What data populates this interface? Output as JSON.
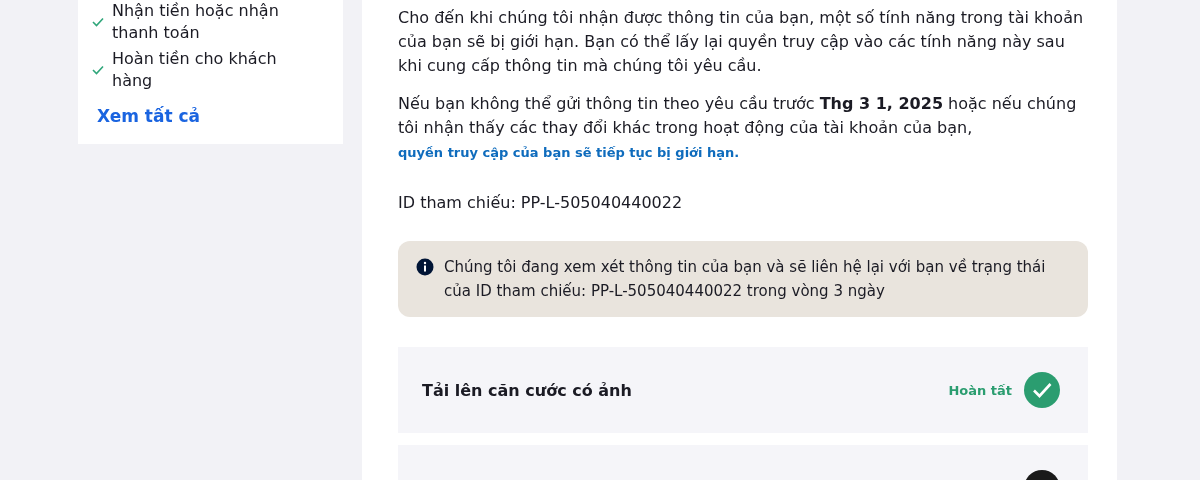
{
  "sidebar": {
    "features": [
      {
        "label": "Nhận tiền hoặc nhận thanh toán",
        "checked": true
      },
      {
        "label": "Hoàn tiền cho khách hàng",
        "checked": true
      }
    ],
    "see_all": "Xem tất cả"
  },
  "main": {
    "paragraph_1": "Cho đến khi chúng tôi nhận được thông tin của bạn, một số tính năng trong tài khoản của bạn sẽ bị giới hạn. Bạn có thể lấy lại quyền truy cập vào các tính năng này sau khi cung cấp thông tin mà chúng tôi yêu cầu.",
    "paragraph_2": "Nếu bạn không thể gửi thông tin theo yêu cầu trước **Thg 3 1, 2025** hoặc nếu chúng tôi nhận thấy các thay đổi khác trong hoạt động của tài khoản của bạn,",
    "paragraph_2_link": "quyền truy cập của bạn sẽ tiếp tục bị giới hạn.",
    "reference_id": "ID tham chiếu: PP-L-505040440022",
    "notice": "Chúng tôi đang xem xét thông tin của bạn và sẽ liên hệ lại với bạn về trạng thái của ID tham chiếu: PP-L-505040440022 trong vòng 3 ngày",
    "steps": [
      {
        "title": "Tải lên căn cước có ảnh",
        "kind": "complete",
        "status_label": "Hoàn tất"
      },
      {
        "kind": "pending"
      }
    ]
  }
}
